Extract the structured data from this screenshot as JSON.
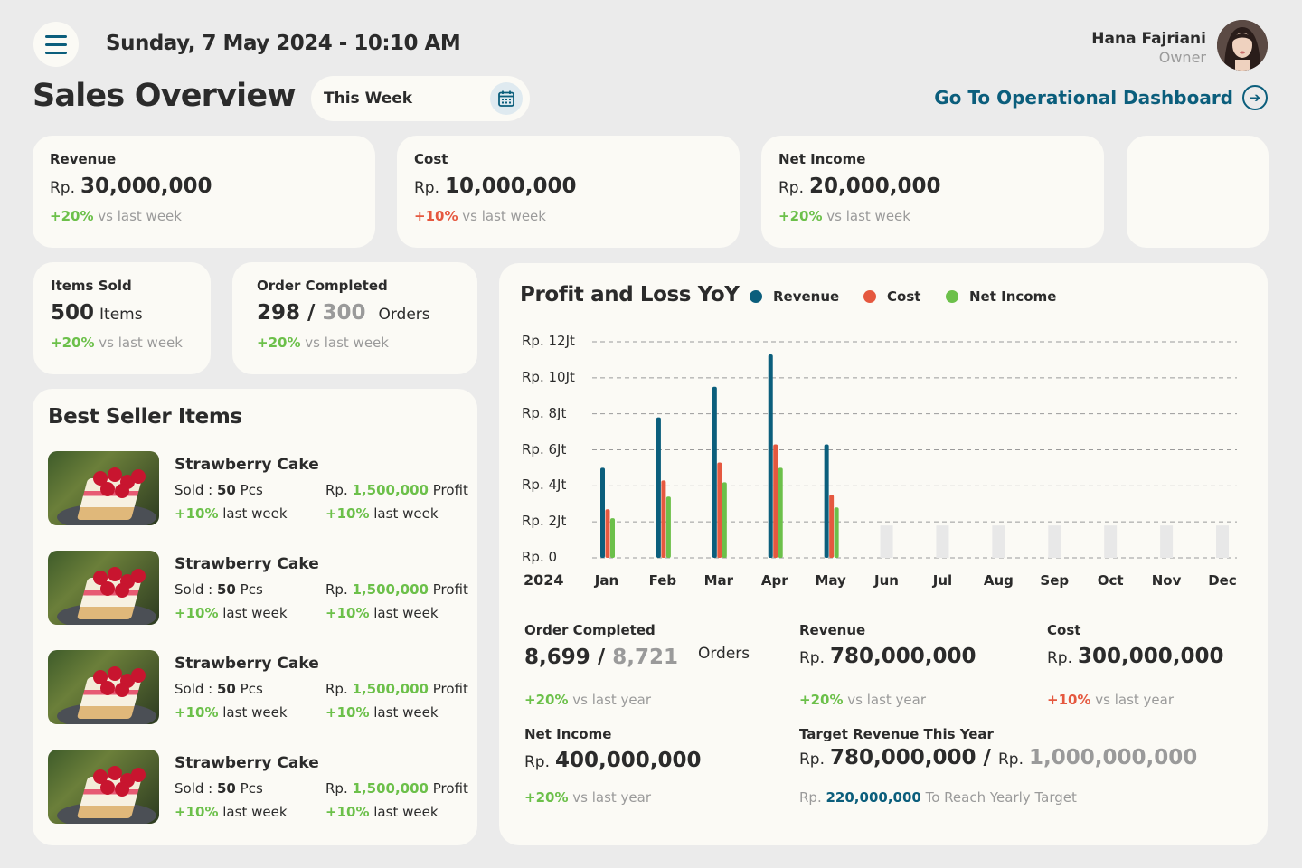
{
  "header": {
    "datetime": "Sunday, 7 May 2024 - 10:10 AM",
    "user_name": "Hana Fajriani",
    "user_role": "Owner",
    "page_title": "Sales Overview",
    "period": "This Week",
    "go_link": "Go To Operational Dashboard"
  },
  "kpis": {
    "revenue": {
      "label": "Revenue",
      "currency": "Rp.",
      "value": "30,000,000",
      "change": "+20%",
      "change_text": "vs last week"
    },
    "cost": {
      "label": "Cost",
      "currency": "Rp.",
      "value": "10,000,000",
      "change": "+10%",
      "change_text": "vs last week"
    },
    "net_income": {
      "label": "Net Income",
      "currency": "Rp.",
      "value": "20,000,000",
      "change": "+20%",
      "change_text": "vs last week"
    },
    "items_sold": {
      "label": "Items Sold",
      "value": "500",
      "unit": "Items",
      "change": "+20%",
      "change_text": "vs last week"
    },
    "order_completed": {
      "label": "Order Completed",
      "value": "298",
      "separator": "/",
      "total": "300",
      "unit": "Orders",
      "change": "+20%",
      "change_text": "vs last week"
    }
  },
  "best_seller": {
    "title": "Best Seller Items",
    "items": [
      {
        "name": "Strawberry Cake",
        "sold_label": "Sold :",
        "sold_value": "50",
        "sold_unit": "Pcs",
        "sold_change": "+10%",
        "sold_change_text": "last week",
        "profit_currency": "Rp.",
        "profit_value": "1,500,000",
        "profit_label": "Profit",
        "profit_change": "+10%",
        "profit_change_text": "last week"
      },
      {
        "name": "Strawberry Cake",
        "sold_label": "Sold :",
        "sold_value": "50",
        "sold_unit": "Pcs",
        "sold_change": "+10%",
        "sold_change_text": "last week",
        "profit_currency": "Rp.",
        "profit_value": "1,500,000",
        "profit_label": "Profit",
        "profit_change": "+10%",
        "profit_change_text": "last week"
      },
      {
        "name": "Strawberry Cake",
        "sold_label": "Sold :",
        "sold_value": "50",
        "sold_unit": "Pcs",
        "sold_change": "+10%",
        "sold_change_text": "last week",
        "profit_currency": "Rp.",
        "profit_value": "1,500,000",
        "profit_label": "Profit",
        "profit_change": "+10%",
        "profit_change_text": "last week"
      },
      {
        "name": "Strawberry Cake",
        "sold_label": "Sold :",
        "sold_value": "50",
        "sold_unit": "Pcs",
        "sold_change": "+10%",
        "sold_change_text": "last week",
        "profit_currency": "Rp.",
        "profit_value": "1,500,000",
        "profit_label": "Profit",
        "profit_change": "+10%",
        "profit_change_text": "last week"
      }
    ]
  },
  "colors": {
    "revenue": "#0b5e7c",
    "cost": "#e5583f",
    "net_income": "#6cc04a",
    "placeholder": "#e8e8e8"
  },
  "chart_data": {
    "type": "bar",
    "title": "Profit and Loss YoY",
    "year_label": "2024",
    "categories": [
      "Jan",
      "Feb",
      "Mar",
      "Apr",
      "May",
      "Jun",
      "Jul",
      "Aug",
      "Sep",
      "Oct",
      "Nov",
      "Dec"
    ],
    "y_ticks": [
      "Rp. 0",
      "Rp. 2Jt",
      "Rp. 4Jt",
      "Rp. 6Jt",
      "Rp. 8Jt",
      "Rp. 10Jt",
      "Rp. 12Jt"
    ],
    "ylim": [
      0,
      12
    ],
    "y_unit": "Jt",
    "grid": true,
    "legend_position": "top",
    "series": [
      {
        "name": "Revenue",
        "values": [
          5.0,
          7.8,
          9.5,
          11.3,
          6.3,
          null,
          null,
          null,
          null,
          null,
          null,
          null
        ]
      },
      {
        "name": "Cost",
        "values": [
          2.7,
          4.3,
          5.3,
          6.3,
          3.5,
          null,
          null,
          null,
          null,
          null,
          null,
          null
        ]
      },
      {
        "name": "Net Income",
        "values": [
          2.2,
          3.4,
          4.2,
          5.0,
          2.8,
          null,
          null,
          null,
          null,
          null,
          null,
          null
        ]
      }
    ],
    "placeholder_value": 1.8
  },
  "yearly": {
    "order_completed": {
      "label": "Order Completed",
      "value": "8,699",
      "separator": "/",
      "total": "8,721",
      "unit": "Orders",
      "change": "+20%",
      "change_text": "vs last year"
    },
    "revenue": {
      "label": "Revenue",
      "currency": "Rp.",
      "value": "780,000,000",
      "change": "+20%",
      "change_text": "vs last year"
    },
    "cost": {
      "label": "Cost",
      "currency": "Rp.",
      "value": "300,000,000",
      "change": "+10%",
      "change_text": "vs last year"
    },
    "net_income": {
      "label": "Net Income",
      "currency": "Rp.",
      "value": "400,000,000",
      "change": "+20%",
      "change_text": "vs last year"
    },
    "target": {
      "label": "Target Revenue This Year",
      "currency": "Rp.",
      "value": "780,000,000",
      "separator": "/",
      "target_currency": "Rp.",
      "target_value": "1,000,000,000",
      "remaining_currency": "Rp.",
      "remaining_value": "220,000,000",
      "remaining_text": "To Reach Yearly Target"
    }
  }
}
